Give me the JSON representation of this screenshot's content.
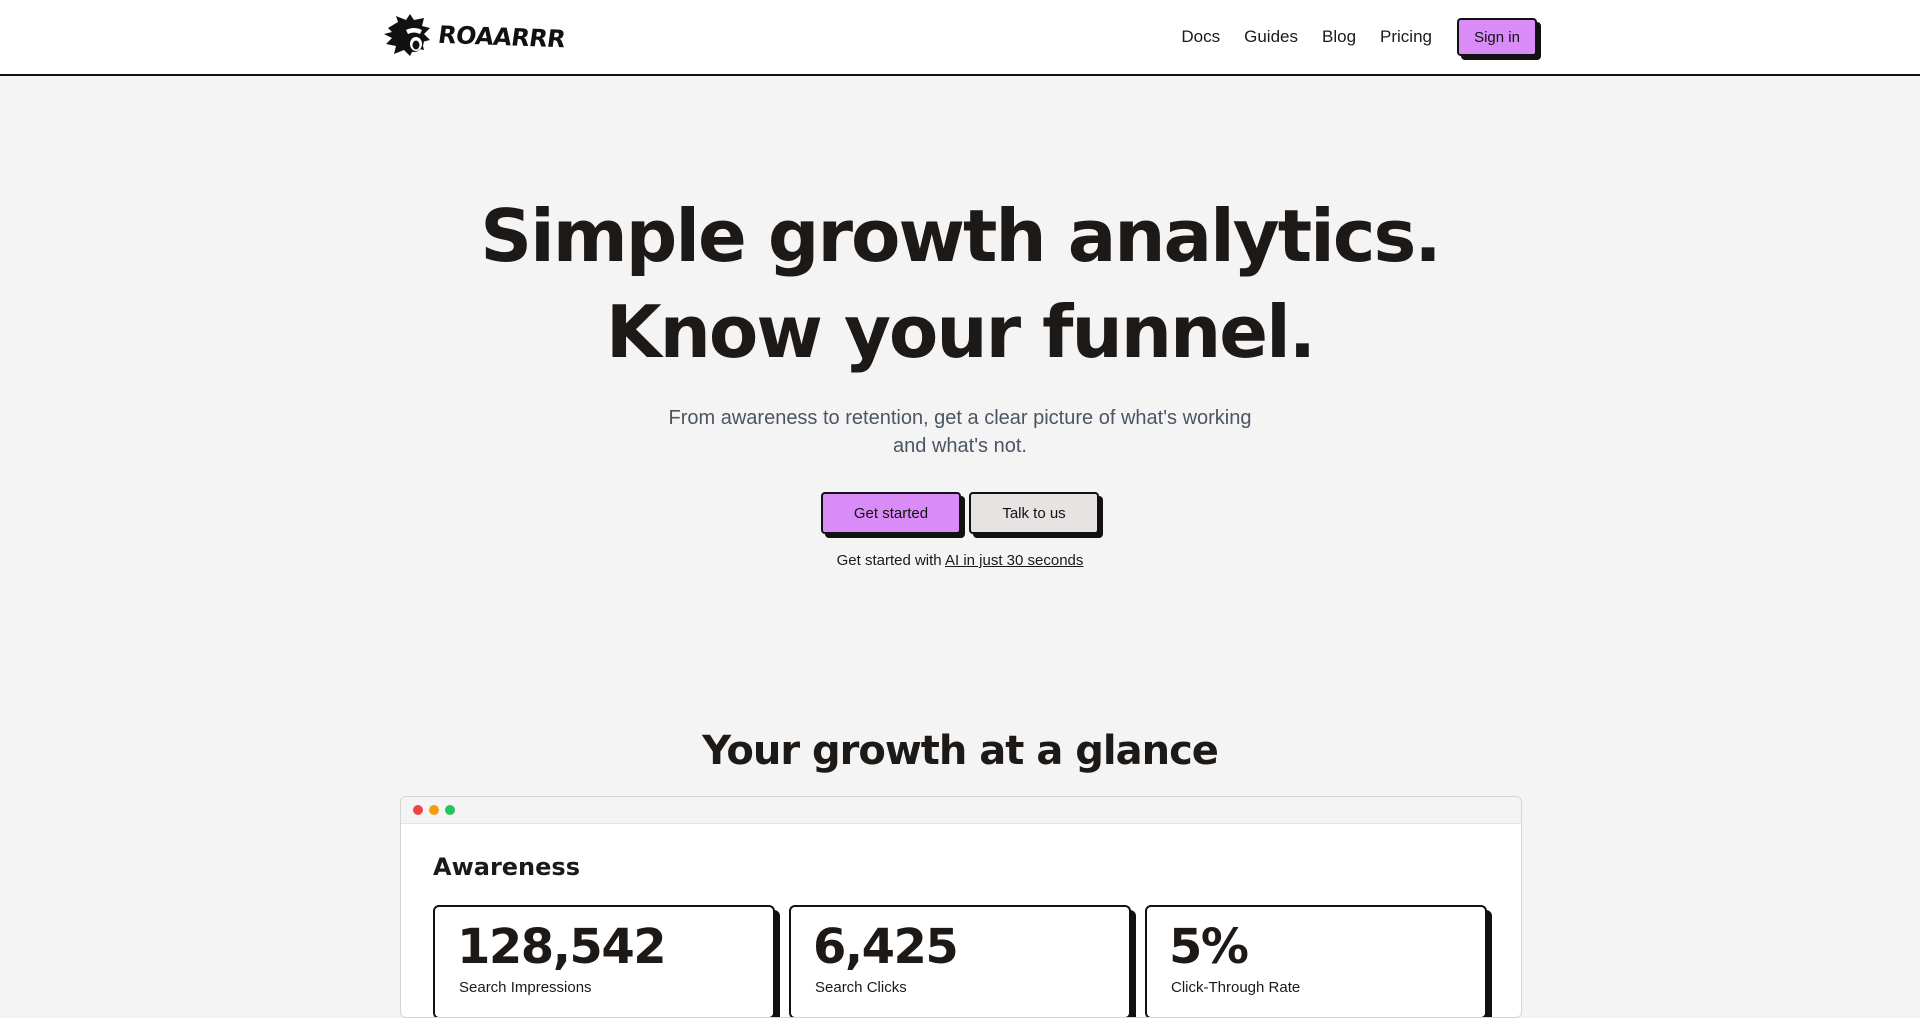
{
  "brand": {
    "name": "ROAARRR",
    "logo_icon": "lion-head-icon"
  },
  "nav": {
    "links": [
      "Docs",
      "Guides",
      "Blog",
      "Pricing"
    ],
    "signin_label": "Sign in"
  },
  "hero": {
    "title_line1": "Simple growth analytics.",
    "title_line2": "Know your funnel.",
    "subtitle": "From awareness to retention, get a clear picture of what's working and what's not.",
    "primary_cta": "Get started",
    "secondary_cta": "Talk to us",
    "ai_prefix": "Get started with ",
    "ai_link": "AI in just 30 seconds"
  },
  "glance": {
    "title": "Your growth at a glance",
    "window_dots": [
      "#ef4444",
      "#f59e0b",
      "#22c55e"
    ],
    "section": "Awareness",
    "cards": [
      {
        "value": "128,542",
        "label": "Search Impressions"
      },
      {
        "value": "6,425",
        "label": "Search Clicks"
      },
      {
        "value": "5%",
        "label": "Click-Through Rate"
      }
    ]
  },
  "colors": {
    "accent": "#d98cf7",
    "secondary_button": "#e7e3e3",
    "page_background": "#f4f4f5",
    "text": "#1c1917"
  }
}
